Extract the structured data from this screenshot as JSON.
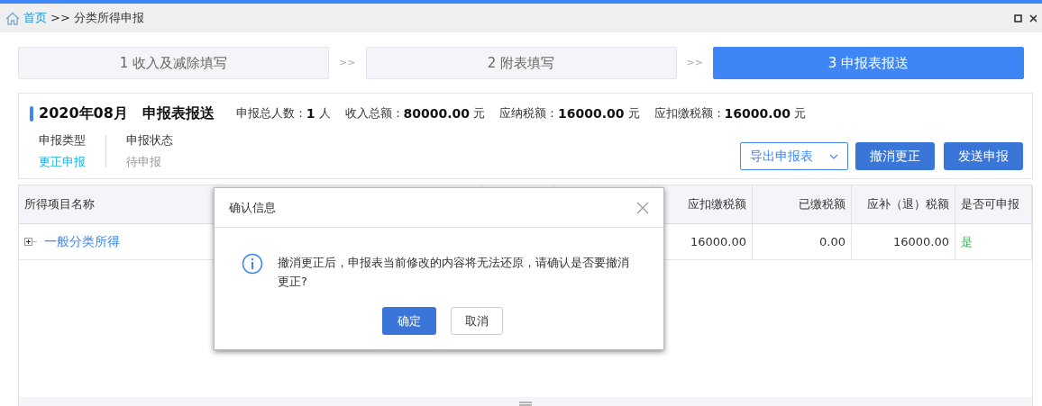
{
  "breadcrumb": {
    "home": "首页",
    "separator": ">>",
    "current": "分类所得申报"
  },
  "steps": [
    {
      "label": "1 收入及减除填写",
      "selected": false
    },
    {
      "label": "2 附表填写",
      "selected": false
    },
    {
      "label": "3 申报表报送",
      "selected": true
    }
  ],
  "step_separator": ">>",
  "summary": {
    "period": "2020年08月",
    "title": "申报表报送",
    "stats": [
      {
        "label": "申报总人数：",
        "value": "1",
        "unit": "人"
      },
      {
        "label": "收入总额：",
        "value": "80000.00",
        "unit": "元"
      },
      {
        "label": "应纳税额：",
        "value": "16000.00",
        "unit": "元"
      },
      {
        "label": "应扣缴税额：",
        "value": "16000.00",
        "unit": "元"
      }
    ],
    "fields": [
      {
        "label": "申报类型",
        "value": "更正申报",
        "kind": "link"
      },
      {
        "label": "申报状态",
        "value": "待申报",
        "kind": "muted"
      }
    ],
    "export_button": "导出申报表",
    "buttons": [
      "撤消更正",
      "发送申报"
    ]
  },
  "table": {
    "first_column": "所得项目名称",
    "columns": [
      "应扣缴税额",
      "已缴税额",
      "应补（退）税额",
      "是否可申报"
    ],
    "rows": [
      {
        "name": "一般分类所得",
        "expanded": false,
        "values": [
          "16000.00",
          "0.00",
          "16000.00"
        ],
        "declarable": "是"
      }
    ]
  },
  "dialog": {
    "title": "确认信息",
    "message": "撤消更正后，申报表当前修改的内容将无法还原，请确认是否要撤消更正?",
    "ok": "确定",
    "cancel": "取消"
  }
}
